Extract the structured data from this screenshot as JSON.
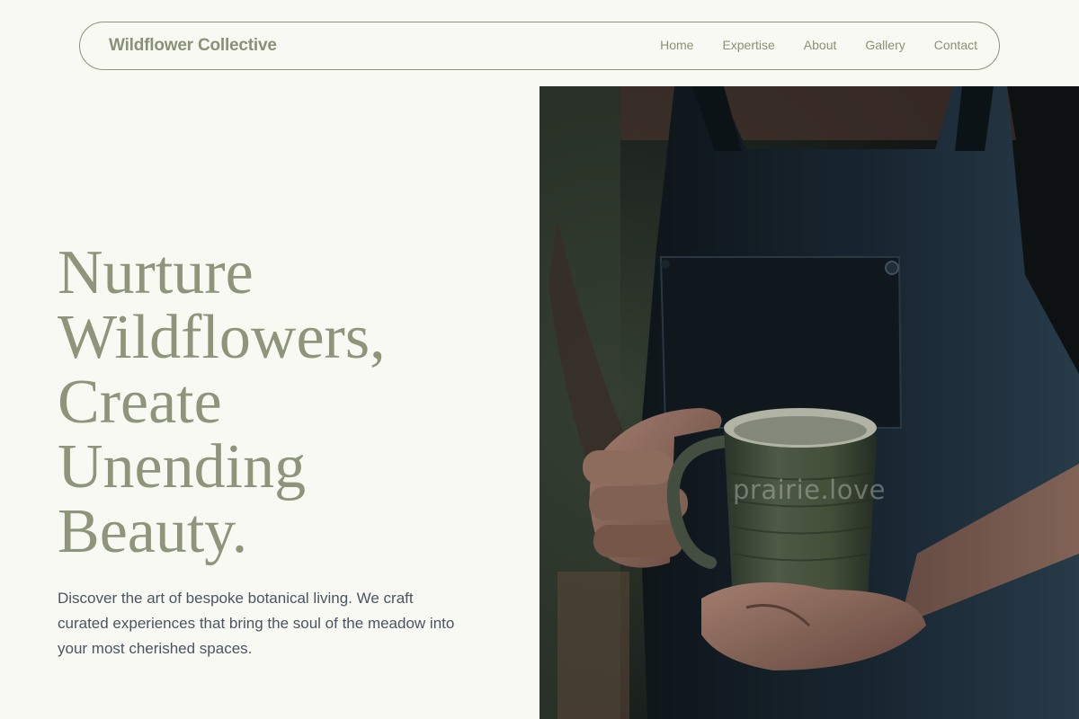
{
  "nav": {
    "brand": "Wildflower Collective",
    "links": [
      "Home",
      "Expertise",
      "About",
      "Gallery",
      "Contact"
    ]
  },
  "hero": {
    "title_lines": [
      "Nurture",
      "Wildflowers,",
      "Create",
      "Unending",
      "Beauty."
    ],
    "subtitle": "Discover the art of bespoke botanical living. We craft curated experiences that bring the soul of the meadow into your most cherished spaces.",
    "image": {
      "watermark": "prairie.love",
      "icon": "photo-person-holding-ceramic-mug"
    }
  },
  "colors": {
    "background": "#f9f9f4",
    "accent": "#8e957a",
    "body_text": "#4a5562",
    "nav_border": "#8d9478"
  }
}
